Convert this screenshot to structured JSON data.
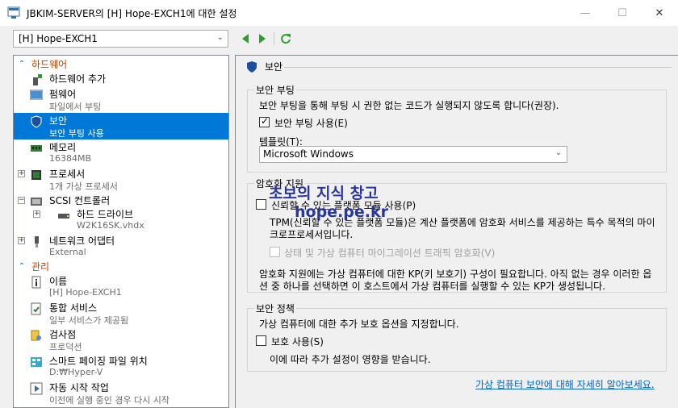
{
  "window": {
    "title": "JBKIM-SERVER의 [H] Hope-EXCH1에 대한 설정",
    "minimize": "—",
    "maximize": "☐",
    "close": "✕"
  },
  "toolbar": {
    "vm_selected": "[H] Hope-EXCH1"
  },
  "tree": {
    "hardware_header": "하드웨어",
    "add_hardware": "하드웨어 추가",
    "firmware": "펌웨어",
    "firmware_sub": "파일에서 부팅",
    "security": "보안",
    "security_sub": "보안 부팅 사용",
    "memory": "메모리",
    "memory_sub": "16384MB",
    "processor": "프로세서",
    "processor_sub": "1개 가상 프로세서",
    "scsi": "SCSI 컨트롤러",
    "hdd": "하드 드라이브",
    "hdd_sub": "W2K16SK.vhdx",
    "net": "네트워크 어댑터",
    "net_sub": "External",
    "mgmt_header": "관리",
    "name": "이름",
    "name_sub": "[H] Hope-EXCH1",
    "integration": "통합 서비스",
    "integration_sub": "일부 서비스가 제공됨",
    "checkpoint": "검사점",
    "checkpoint_sub": "프로덕션",
    "paging": "스마트 페이징 파일 위치",
    "paging_sub": "D:₩Hyper-V",
    "autostart": "자동 시작 작업",
    "autostart_sub": "이전에 실행 중인 경우 다시 시작"
  },
  "panel": {
    "title": "보안",
    "secure_boot": {
      "label": "보안 부팅",
      "desc": "보안 부팅을 통해 부팅 시 권한 없는 코드가 실행되지 않도록 합니다(권장).",
      "checkbox": "보안 부팅 사용(E)",
      "checked": true,
      "template_label": "템플릿(T):",
      "template_value": "Microsoft Windows"
    },
    "encryption": {
      "label": "암호화 지원",
      "tpm_checkbox": "신뢰할 수 있는 플랫폼 모듈 사용(P)",
      "tpm_desc1": "TPM(신뢰할 수 있는 플랫폼 모듈)은 계산 플랫폼에 암호화 서비스를 제공하는 특수 목적의 마이",
      "tpm_desc2": "크로프로세서입니다.",
      "traffic_checkbox": "상태 및 가상 컴퓨터 마이그레이션 트래픽 암호화(V)",
      "kp_desc1": "암호화 지원에는 가상 컴퓨터에 대한 KP(키 보호기) 구성이 필요합니다. 아직 없는 경우 이러한 옵",
      "kp_desc2": "션 중 하나를 선택하면 이 호스트에서 가상 컴퓨터를 실행할 수 있는 KP가 생성됩니다."
    },
    "policy": {
      "label": "보안 정책",
      "desc": "가상 컴퓨터에 대한 추가 보호 옵션을 지정합니다.",
      "checkbox": "보호 사용(S)",
      "note": "이에 따라 추가 설정이 영향을 받습니다."
    },
    "learn_more": "가상 컴퓨터 보안에 대해 자세히 알아보세요."
  },
  "watermark": {
    "line1": "초보의 지식 창고",
    "line2": "hope.pe.kr"
  },
  "colors": {
    "selection": "#0078d7",
    "section_header": "#c04000",
    "link": "#0066cc"
  }
}
